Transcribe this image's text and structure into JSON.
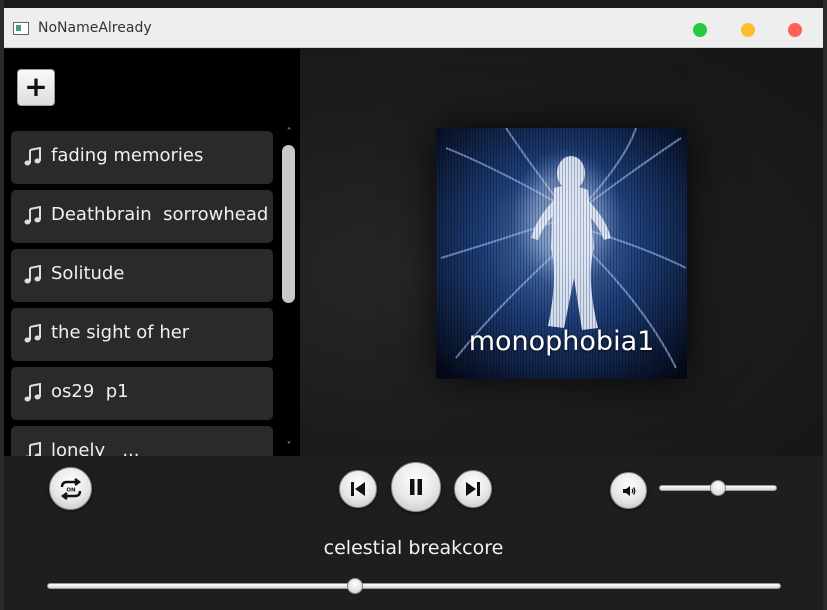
{
  "window": {
    "title": "NoNameAlready"
  },
  "sidebar": {
    "add_label": "+",
    "songs": [
      {
        "label": "fading memories"
      },
      {
        "label": "Deathbrain  sorrowhead"
      },
      {
        "label": "Solitude"
      },
      {
        "label": "the sight of her"
      },
      {
        "label": "os29  p1"
      },
      {
        "label": "lonely   ..."
      }
    ]
  },
  "album": {
    "title": "monophobia1"
  },
  "player": {
    "now_playing": "celestial breakcore",
    "repeat_badge": "ON",
    "progress": 0.42,
    "volume": 0.5
  },
  "colors": {
    "window_button_green": "#28c840",
    "window_button_yellow": "#febc2e",
    "window_button_red": "#ff5f57",
    "background": "#1a1a1a",
    "song_item": "#2a2a2a"
  },
  "icons": [
    "app-icon",
    "music-note-icon",
    "repeat-icon",
    "previous-icon",
    "pause-icon",
    "next-icon",
    "volume-icon"
  ]
}
